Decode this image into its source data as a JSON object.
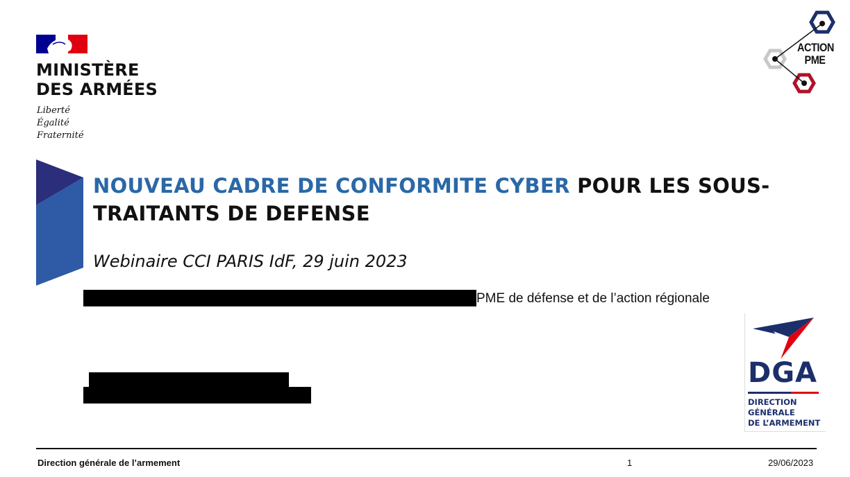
{
  "ministry": {
    "name_line1": "MINISTÈRE",
    "name_line2": "DES ARMÉES",
    "motto": [
      "Liberté",
      "Égalité",
      "Fraternité"
    ]
  },
  "action_pme": {
    "line1": "ACTION",
    "line2": "PME"
  },
  "title": {
    "highlight": "NOUVEAU CADRE DE CONFORMITE CYBER",
    "rest": " POUR LES SOUS-TRAITANTS DE DEFENSE"
  },
  "subtitle": "Webinaire CCI PARIS IdF, 29 juin 2023",
  "speaker": {
    "role_visible": "PME de défense et de l’action régionale"
  },
  "dga": {
    "acronym": "DGA",
    "full_line1": "DIRECTION",
    "full_line2": "GÉNÉRALE",
    "full_line3": "DE L’ARMEMENT"
  },
  "footer": {
    "left": "Direction générale de l’armement",
    "page": "1",
    "date": "29/06/2023"
  },
  "colors": {
    "title_blue": "#2a68a7",
    "navy": "#1c2f6b",
    "red": "#e1000f",
    "france_blue": "#000091"
  }
}
